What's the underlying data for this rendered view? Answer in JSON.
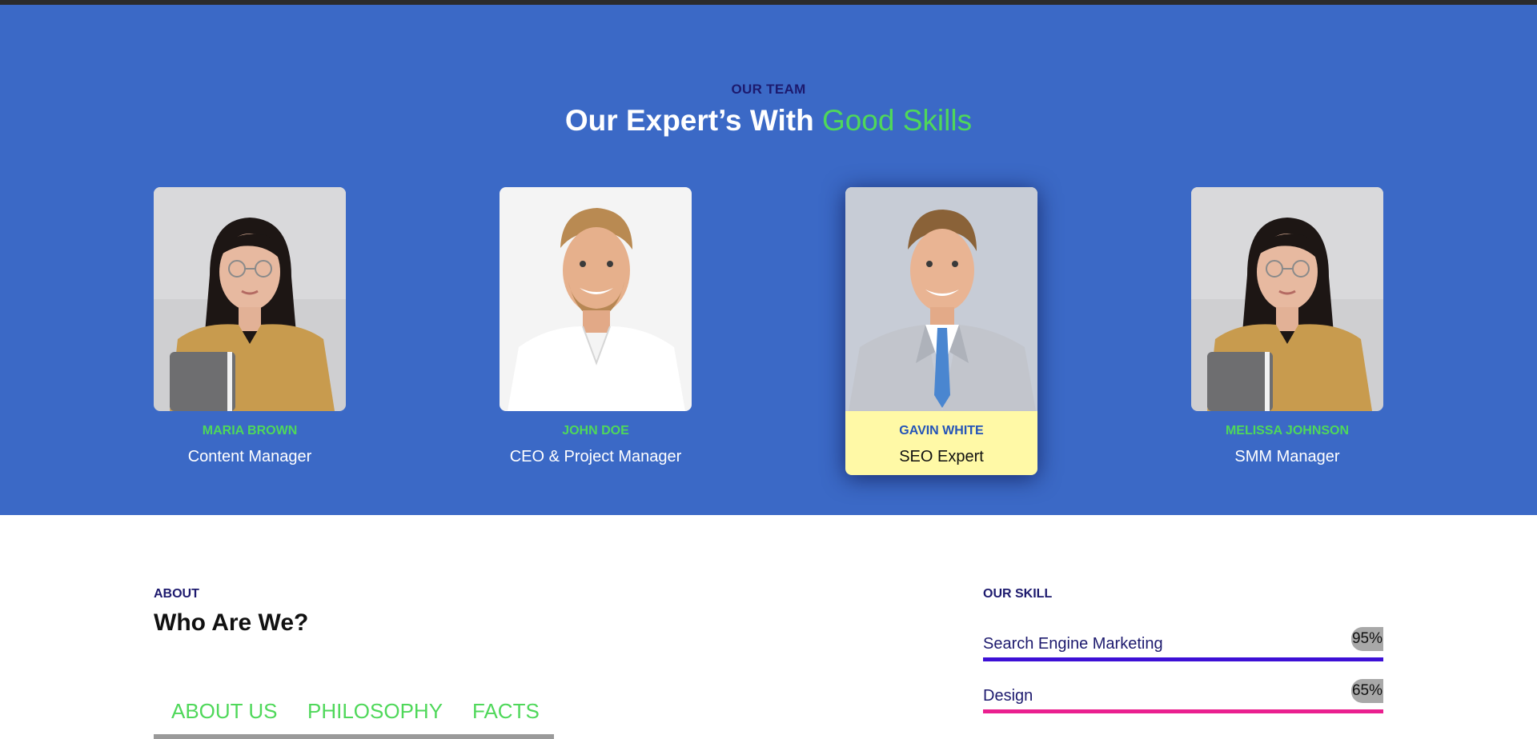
{
  "team": {
    "eyebrow": "OUR TEAM",
    "heading_main": "Our Expert’s With",
    "heading_accent": "Good Skills",
    "members": [
      {
        "name": "MARIA BROWN",
        "role": "Content Manager",
        "photo": "woman-portrait-icon"
      },
      {
        "name": "JOHN DOE",
        "role": "CEO & Project Manager",
        "photo": "man-portrait-icon"
      },
      {
        "name": "GAVIN WHITE",
        "role": "SEO Expert",
        "photo": "man-suit-portrait-icon",
        "active": true
      },
      {
        "name": "MELISSA JOHNSON",
        "role": "SMM Manager",
        "photo": "woman-portrait-icon"
      }
    ]
  },
  "about": {
    "eyebrow": "ABOUT",
    "title": "Who Are We?",
    "tabs": [
      "ABOUT US",
      "PHILOSOPHY",
      "FACTS"
    ]
  },
  "skills": {
    "eyebrow": "OUR SKILL",
    "items": [
      {
        "label": "Search Engine Marketing",
        "percent": "95%",
        "value": 95,
        "color": "#3d10d6"
      },
      {
        "label": "Design",
        "percent": "65%",
        "value": 65,
        "color": "#ea1f8f"
      }
    ]
  },
  "colors": {
    "team_bg": "#3b69c6",
    "accent_green": "#4fd85a",
    "active_card_bg": "#fff9a6",
    "dark_navy": "#1d1a6e"
  }
}
